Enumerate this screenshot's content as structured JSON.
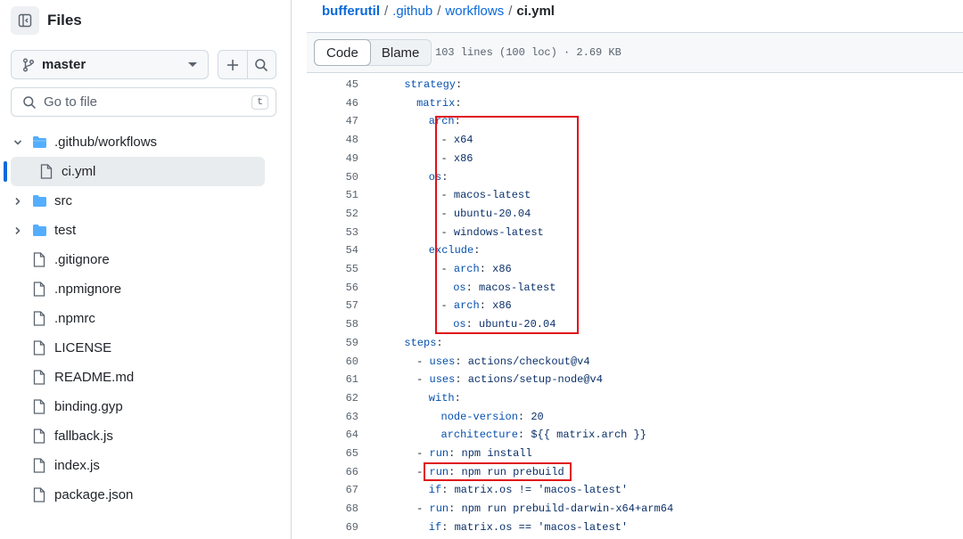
{
  "sidebar": {
    "title": "Files",
    "branch": "master",
    "search_placeholder": "Go to file",
    "search_shortcut": "t",
    "tree": [
      {
        "name": ".github/workflows",
        "kind": "folder",
        "expanded": true
      },
      {
        "name": "ci.yml",
        "kind": "file",
        "selected": true
      },
      {
        "name": "src",
        "kind": "folder",
        "expanded": false
      },
      {
        "name": "test",
        "kind": "folder",
        "expanded": false
      },
      {
        "name": ".gitignore",
        "kind": "file"
      },
      {
        "name": ".npmignore",
        "kind": "file"
      },
      {
        "name": ".npmrc",
        "kind": "file"
      },
      {
        "name": "LICENSE",
        "kind": "file"
      },
      {
        "name": "README.md",
        "kind": "file"
      },
      {
        "name": "binding.gyp",
        "kind": "file"
      },
      {
        "name": "fallback.js",
        "kind": "file"
      },
      {
        "name": "index.js",
        "kind": "file"
      },
      {
        "name": "package.json",
        "kind": "file"
      }
    ]
  },
  "breadcrumb": {
    "repo": "bufferutil",
    "dir1": ".github",
    "dir2": "workflows",
    "file": "ci.yml",
    "separator": "/"
  },
  "toolbar": {
    "code_label": "Code",
    "blame_label": "Blame",
    "meta": "103 lines (100 loc) · 2.69 KB"
  },
  "code_lines": [
    {
      "n": "45",
      "indent": 4,
      "key": "strategy",
      "val": ""
    },
    {
      "n": "46",
      "indent": 6,
      "key": "matrix",
      "val": ""
    },
    {
      "n": "47",
      "indent": 8,
      "key": "arch",
      "val": ""
    },
    {
      "n": "48",
      "indent": 10,
      "dash": true,
      "val": "x64"
    },
    {
      "n": "49",
      "indent": 10,
      "dash": true,
      "val": "x86"
    },
    {
      "n": "50",
      "indent": 8,
      "key": "os",
      "val": ""
    },
    {
      "n": "51",
      "indent": 10,
      "dash": true,
      "val": "macos-latest"
    },
    {
      "n": "52",
      "indent": 10,
      "dash": true,
      "val": "ubuntu-20.04"
    },
    {
      "n": "53",
      "indent": 10,
      "dash": true,
      "val": "windows-latest"
    },
    {
      "n": "54",
      "indent": 8,
      "key": "exclude",
      "val": ""
    },
    {
      "n": "55",
      "indent": 10,
      "dash": true,
      "key": "arch",
      "val": "x86"
    },
    {
      "n": "56",
      "indent": 12,
      "key": "os",
      "val": "macos-latest"
    },
    {
      "n": "57",
      "indent": 10,
      "dash": true,
      "key": "arch",
      "val": "x86"
    },
    {
      "n": "58",
      "indent": 12,
      "key": "os",
      "val": "ubuntu-20.04"
    },
    {
      "n": "59",
      "indent": 4,
      "key": "steps",
      "val": ""
    },
    {
      "n": "60",
      "indent": 6,
      "dash": true,
      "key": "uses",
      "val": "actions/checkout@v4"
    },
    {
      "n": "61",
      "indent": 6,
      "dash": true,
      "key": "uses",
      "val": "actions/setup-node@v4"
    },
    {
      "n": "62",
      "indent": 8,
      "key": "with",
      "val": ""
    },
    {
      "n": "63",
      "indent": 10,
      "key": "node-version",
      "val": "20"
    },
    {
      "n": "64",
      "indent": 10,
      "key": "architecture",
      "val": "${{ matrix.arch }}"
    },
    {
      "n": "65",
      "indent": 6,
      "dash": true,
      "key": "run",
      "val": "npm install"
    },
    {
      "n": "66",
      "indent": 6,
      "dash": true,
      "key": "run",
      "val": "npm run prebuild"
    },
    {
      "n": "67",
      "indent": 8,
      "key": "if",
      "val": "matrix.os != 'macos-latest'"
    },
    {
      "n": "68",
      "indent": 6,
      "dash": true,
      "key": "run",
      "val": "npm run prebuild-darwin-x64+arm64"
    },
    {
      "n": "69",
      "indent": 8,
      "key": "if",
      "val": "matrix.os == 'macos-latest'"
    }
  ],
  "colors": {
    "accent": "#0969da",
    "highlight_box": "#e0121a",
    "folder": "#54aeff",
    "yaml_key": "#0550ae"
  }
}
